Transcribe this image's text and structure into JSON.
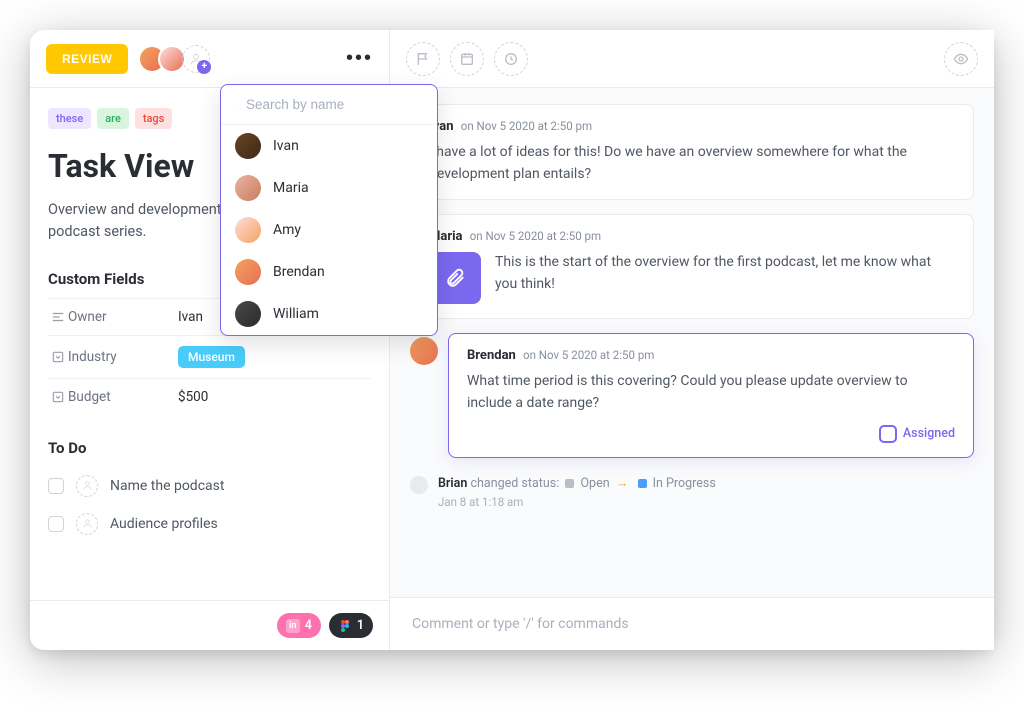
{
  "header": {
    "review_label": "REVIEW"
  },
  "tags": [
    "these",
    "are",
    "tags"
  ],
  "task": {
    "title": "Task View",
    "description": "Overview and development plan for original podcast series."
  },
  "custom_fields": {
    "heading": "Custom Fields",
    "rows": [
      {
        "label": "Owner",
        "value": "Ivan"
      },
      {
        "label": "Industry",
        "value": "Museum"
      },
      {
        "label": "Budget",
        "value": "$500"
      }
    ]
  },
  "todo": {
    "heading": "To Do",
    "items": [
      "Name the podcast",
      "Audience profiles"
    ]
  },
  "footer": {
    "count_a": "4",
    "count_b": "1"
  },
  "dropdown": {
    "placeholder": "Search by name",
    "options": [
      "Ivan",
      "Maria",
      "Amy",
      "Brendan",
      "William"
    ]
  },
  "comments": [
    {
      "author": "Ivan",
      "date": "on Nov 5 2020 at 2:50 pm",
      "body": "I have a lot of ideas for this! Do we have an overview somewhere for what the development plan entails?"
    },
    {
      "author": "Maria",
      "date": "on Nov 5 2020 at 2:50 pm",
      "body": "This is the start of the overview for the first podcast, let me know what you think!"
    },
    {
      "author": "Brendan",
      "date": "on Nov 5 2020 at 2:50 pm",
      "body": "What time period is this covering? Could you please update overview to include a date range?",
      "assigned_label": "Assigned"
    }
  ],
  "activity": {
    "user": "Brian",
    "action": "changed status:",
    "from": "Open",
    "to": "In Progress",
    "time": "Jan 8 at 1:18 am"
  },
  "composer": {
    "placeholder": "Comment or type '/' for commands"
  }
}
